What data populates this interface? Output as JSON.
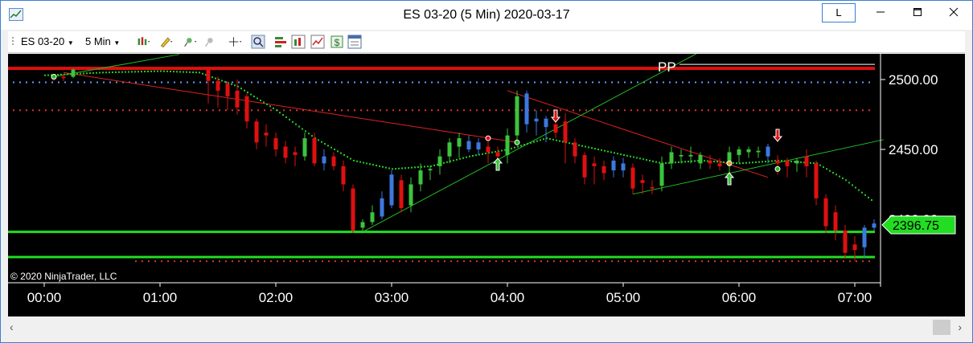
{
  "window": {
    "title": "ES 03-20 (5 Min)  2020-03-17",
    "l_button": "L",
    "minimize": "—",
    "maximize": "☐",
    "close": "✕"
  },
  "toolbar": {
    "instrument": "ES 03-20",
    "interval": "5 Min",
    "icons": [
      "bar-style-icon",
      "drawing-tool-icon",
      "pin-icon",
      "unpin-icon",
      "crosshair-icon",
      "zoom-icon",
      "strategy-icon",
      "indicators-icon",
      "chart-trader-icon",
      "money-icon",
      "properties-icon"
    ]
  },
  "chart": {
    "copyright": "© 2020 NinjaTrader, LLC",
    "pivot_label": "PP",
    "price_labels": [
      "2500.00",
      "2450.00"
    ],
    "current_price": "2396.75",
    "time_labels": [
      "00:00",
      "01:00",
      "02:00",
      "03:00",
      "04:00",
      "05:00",
      "06:00",
      "07:00"
    ],
    "colors": {
      "up_bar": "#3cc43c",
      "down_bar": "#e01010",
      "neutral_bar": "#3c78e0",
      "pivot_line": "#e01010",
      "support_line": "#22dd22",
      "ma": "#22cc22"
    }
  },
  "chart_data": {
    "type": "candlestick",
    "title": "ES 03-20 (5 Min)  2020-03-17",
    "y_ticks": [
      2500.0,
      2450.0
    ],
    "ylim": [
      2365,
      2515
    ],
    "x_ticks": [
      "00:00",
      "01:00",
      "02:00",
      "03:00",
      "04:00",
      "05:00",
      "06:00",
      "07:00"
    ],
    "pivot_pp": 2508,
    "support_levels": [
      2391,
      2373
    ],
    "last_price": 2396.75,
    "bars": [
      {
        "t": "00:05",
        "o": 2501,
        "h": 2503,
        "l": 2499,
        "c": 2500,
        "col": "d"
      },
      {
        "t": "00:10",
        "o": 2501,
        "h": 2504,
        "l": 2499,
        "c": 2502,
        "col": "d"
      },
      {
        "t": "00:15",
        "o": 2502,
        "h": 2508,
        "l": 2501,
        "c": 2507,
        "col": "u"
      },
      {
        "t": "01:25",
        "o": 2508,
        "h": 2509,
        "l": 2483,
        "c": 2499,
        "col": "d"
      },
      {
        "t": "01:30",
        "o": 2499,
        "h": 2502,
        "l": 2480,
        "c": 2492,
        "col": "d"
      },
      {
        "t": "01:35",
        "o": 2497,
        "h": 2499,
        "l": 2478,
        "c": 2488,
        "col": "d"
      },
      {
        "t": "01:40",
        "o": 2492,
        "h": 2500,
        "l": 2475,
        "c": 2480,
        "col": "d"
      },
      {
        "t": "01:45",
        "o": 2488,
        "h": 2490,
        "l": 2465,
        "c": 2470,
        "col": "d"
      },
      {
        "t": "01:50",
        "o": 2470,
        "h": 2472,
        "l": 2450,
        "c": 2455,
        "col": "d"
      },
      {
        "t": "01:55",
        "o": 2462,
        "h": 2468,
        "l": 2452,
        "c": 2460,
        "col": "d"
      },
      {
        "t": "02:00",
        "o": 2458,
        "h": 2462,
        "l": 2445,
        "c": 2450,
        "col": "d"
      },
      {
        "t": "02:05",
        "o": 2452,
        "h": 2456,
        "l": 2440,
        "c": 2444,
        "col": "d"
      },
      {
        "t": "02:10",
        "o": 2448,
        "h": 2452,
        "l": 2438,
        "c": 2446,
        "col": "d"
      },
      {
        "t": "02:15",
        "o": 2445,
        "h": 2462,
        "l": 2442,
        "c": 2458,
        "col": "u"
      },
      {
        "t": "02:20",
        "o": 2458,
        "h": 2462,
        "l": 2438,
        "c": 2440,
        "col": "d"
      },
      {
        "t": "02:25",
        "o": 2440,
        "h": 2450,
        "l": 2435,
        "c": 2445,
        "col": "n"
      },
      {
        "t": "02:30",
        "o": 2445,
        "h": 2448,
        "l": 2435,
        "c": 2438,
        "col": "d"
      },
      {
        "t": "02:35",
        "o": 2438,
        "h": 2442,
        "l": 2420,
        "c": 2425,
        "col": "d"
      },
      {
        "t": "02:40",
        "o": 2422,
        "h": 2425,
        "l": 2390,
        "c": 2392,
        "col": "d"
      },
      {
        "t": "02:45",
        "o": 2394,
        "h": 2400,
        "l": 2390,
        "c": 2398,
        "col": "u"
      },
      {
        "t": "02:50",
        "o": 2398,
        "h": 2410,
        "l": 2396,
        "c": 2405,
        "col": "u"
      },
      {
        "t": "02:55",
        "o": 2402,
        "h": 2420,
        "l": 2400,
        "c": 2415,
        "col": "n"
      },
      {
        "t": "03:00",
        "o": 2410,
        "h": 2435,
        "l": 2408,
        "c": 2432,
        "col": "n"
      },
      {
        "t": "03:05",
        "o": 2428,
        "h": 2432,
        "l": 2405,
        "c": 2408,
        "col": "d"
      },
      {
        "t": "03:10",
        "o": 2410,
        "h": 2430,
        "l": 2405,
        "c": 2425,
        "col": "u"
      },
      {
        "t": "03:15",
        "o": 2425,
        "h": 2440,
        "l": 2420,
        "c": 2435,
        "col": "u"
      },
      {
        "t": "03:20",
        "o": 2435,
        "h": 2438,
        "l": 2428,
        "c": 2436,
        "col": "u"
      },
      {
        "t": "03:25",
        "o": 2438,
        "h": 2450,
        "l": 2432,
        "c": 2445,
        "col": "u"
      },
      {
        "t": "03:30",
        "o": 2445,
        "h": 2458,
        "l": 2440,
        "c": 2455,
        "col": "u"
      },
      {
        "t": "03:35",
        "o": 2452,
        "h": 2462,
        "l": 2444,
        "c": 2458,
        "col": "u"
      },
      {
        "t": "03:40",
        "o": 2456,
        "h": 2460,
        "l": 2448,
        "c": 2450,
        "col": "n"
      },
      {
        "t": "03:45",
        "o": 2450,
        "h": 2458,
        "l": 2446,
        "c": 2455,
        "col": "n"
      },
      {
        "t": "03:50",
        "o": 2448,
        "h": 2456,
        "l": 2440,
        "c": 2452,
        "col": "d"
      },
      {
        "t": "03:55",
        "o": 2445,
        "h": 2452,
        "l": 2438,
        "c": 2448,
        "col": "d"
      },
      {
        "t": "04:00",
        "o": 2446,
        "h": 2465,
        "l": 2440,
        "c": 2460,
        "col": "u"
      },
      {
        "t": "04:05",
        "o": 2460,
        "h": 2492,
        "l": 2455,
        "c": 2488,
        "col": "u"
      },
      {
        "t": "04:10",
        "o": 2490,
        "h": 2492,
        "l": 2462,
        "c": 2468,
        "col": "n"
      },
      {
        "t": "04:15",
        "o": 2470,
        "h": 2478,
        "l": 2460,
        "c": 2472,
        "col": "n"
      },
      {
        "t": "04:20",
        "o": 2472,
        "h": 2474,
        "l": 2455,
        "c": 2466,
        "col": "n"
      },
      {
        "t": "04:25",
        "o": 2468,
        "h": 2470,
        "l": 2458,
        "c": 2462,
        "col": "d"
      },
      {
        "t": "04:30",
        "o": 2470,
        "h": 2476,
        "l": 2440,
        "c": 2455,
        "col": "d"
      },
      {
        "t": "04:35",
        "o": 2455,
        "h": 2458,
        "l": 2440,
        "c": 2445,
        "col": "d"
      },
      {
        "t": "04:40",
        "o": 2446,
        "h": 2448,
        "l": 2425,
        "c": 2430,
        "col": "d"
      },
      {
        "t": "04:45",
        "o": 2438,
        "h": 2445,
        "l": 2425,
        "c": 2440,
        "col": "d"
      },
      {
        "t": "04:50",
        "o": 2438,
        "h": 2442,
        "l": 2428,
        "c": 2433,
        "col": "d"
      },
      {
        "t": "04:55",
        "o": 2435,
        "h": 2445,
        "l": 2430,
        "c": 2442,
        "col": "n"
      },
      {
        "t": "05:00",
        "o": 2440,
        "h": 2444,
        "l": 2430,
        "c": 2435,
        "col": "n"
      },
      {
        "t": "05:05",
        "o": 2437,
        "h": 2440,
        "l": 2418,
        "c": 2422,
        "col": "d"
      },
      {
        "t": "05:10",
        "o": 2428,
        "h": 2432,
        "l": 2418,
        "c": 2426,
        "col": "d"
      },
      {
        "t": "05:15",
        "o": 2422,
        "h": 2428,
        "l": 2418,
        "c": 2423,
        "col": "d"
      },
      {
        "t": "05:20",
        "o": 2424,
        "h": 2445,
        "l": 2420,
        "c": 2440,
        "col": "u"
      },
      {
        "t": "05:25",
        "o": 2440,
        "h": 2452,
        "l": 2436,
        "c": 2448,
        "col": "u"
      },
      {
        "t": "05:30",
        "o": 2446,
        "h": 2450,
        "l": 2440,
        "c": 2445,
        "col": "u"
      },
      {
        "t": "05:35",
        "o": 2445,
        "h": 2452,
        "l": 2440,
        "c": 2446,
        "col": "u"
      },
      {
        "t": "05:40",
        "o": 2446,
        "h": 2448,
        "l": 2436,
        "c": 2440,
        "col": "u"
      },
      {
        "t": "05:45",
        "o": 2442,
        "h": 2446,
        "l": 2436,
        "c": 2440,
        "col": "d"
      },
      {
        "t": "05:50",
        "o": 2440,
        "h": 2444,
        "l": 2435,
        "c": 2438,
        "col": "d"
      },
      {
        "t": "05:55",
        "o": 2440,
        "h": 2452,
        "l": 2430,
        "c": 2448,
        "col": "u"
      },
      {
        "t": "06:00",
        "o": 2446,
        "h": 2452,
        "l": 2440,
        "c": 2450,
        "col": "u"
      },
      {
        "t": "06:05",
        "o": 2448,
        "h": 2452,
        "l": 2444,
        "c": 2450,
        "col": "u"
      },
      {
        "t": "06:10",
        "o": 2448,
        "h": 2452,
        "l": 2444,
        "c": 2449,
        "col": "u"
      },
      {
        "t": "06:15",
        "o": 2452,
        "h": 2454,
        "l": 2440,
        "c": 2445,
        "col": "n"
      },
      {
        "t": "06:20",
        "o": 2442,
        "h": 2446,
        "l": 2432,
        "c": 2440,
        "col": "d"
      },
      {
        "t": "06:25",
        "o": 2438,
        "h": 2444,
        "l": 2430,
        "c": 2442,
        "col": "d"
      },
      {
        "t": "06:30",
        "o": 2440,
        "h": 2444,
        "l": 2434,
        "c": 2442,
        "col": "u"
      },
      {
        "t": "06:35",
        "o": 2445,
        "h": 2450,
        "l": 2430,
        "c": 2438,
        "col": "d"
      },
      {
        "t": "06:40",
        "o": 2440,
        "h": 2442,
        "l": 2410,
        "c": 2415,
        "col": "d"
      },
      {
        "t": "06:45",
        "o": 2415,
        "h": 2418,
        "l": 2390,
        "c": 2395,
        "col": "d"
      },
      {
        "t": "06:50",
        "o": 2405,
        "h": 2410,
        "l": 2385,
        "c": 2392,
        "col": "d"
      },
      {
        "t": "06:55",
        "o": 2392,
        "h": 2396,
        "l": 2372,
        "c": 2376,
        "col": "d"
      },
      {
        "t": "07:00",
        "o": 2378,
        "h": 2388,
        "l": 2370,
        "c": 2382,
        "col": "d"
      },
      {
        "t": "07:05",
        "o": 2380,
        "h": 2396,
        "l": 2372,
        "c": 2394,
        "col": "n"
      },
      {
        "t": "07:10",
        "o": 2394,
        "h": 2400,
        "l": 2392,
        "c": 2397,
        "col": "n"
      }
    ]
  }
}
